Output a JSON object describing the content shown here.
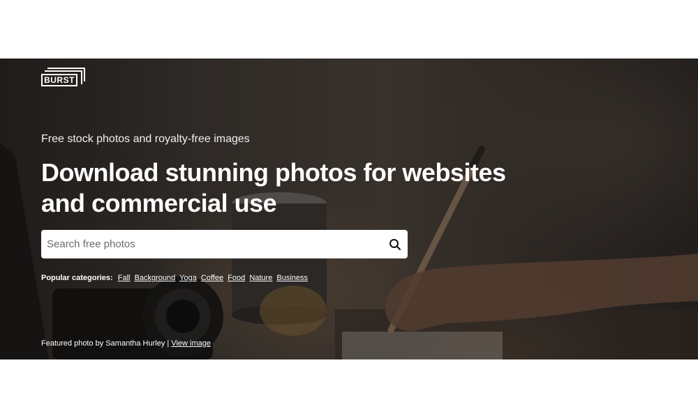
{
  "brand": {
    "logo_text": "BURST"
  },
  "hero": {
    "tagline": "Free stock photos and royalty-free images",
    "headline": "Download stunning photos for websites and commercial use"
  },
  "search": {
    "placeholder": "Search free photos",
    "icon": "search-icon"
  },
  "categories": {
    "label": "Popular categories:",
    "items": [
      "Fall",
      "Background",
      "Yoga",
      "Coffee",
      "Food",
      "Nature",
      "Business"
    ]
  },
  "credit": {
    "text": "Featured photo by Samantha Hurley |",
    "link": "View image"
  }
}
